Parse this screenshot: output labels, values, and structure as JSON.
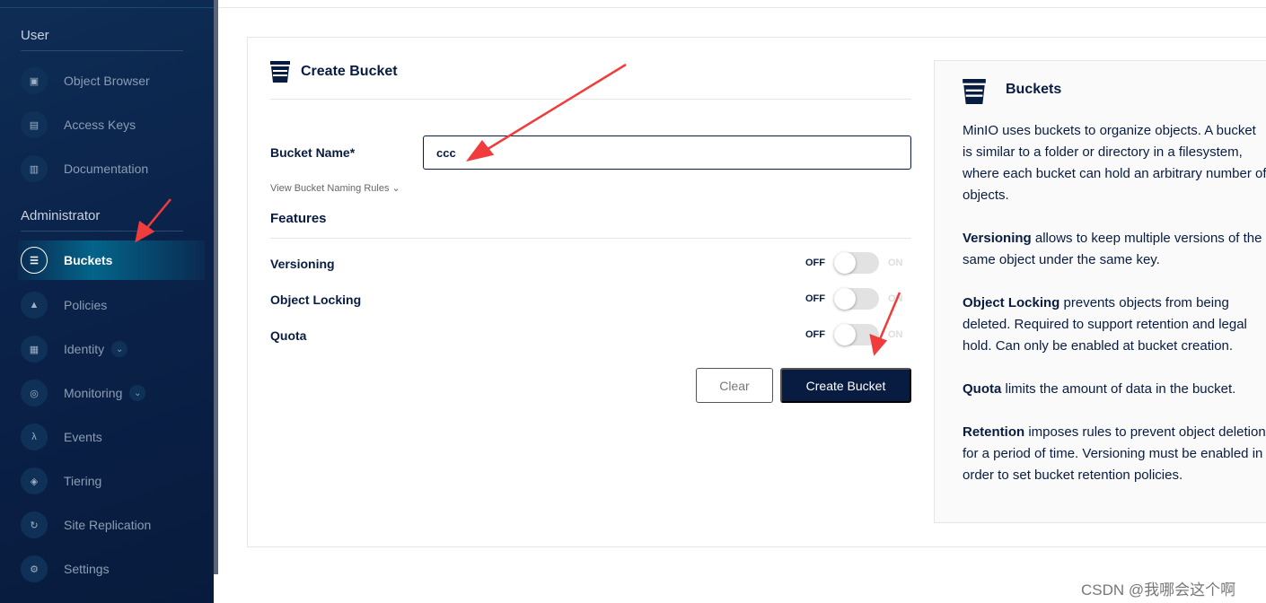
{
  "sidebar": {
    "sections": {
      "user": "User",
      "admin": "Administrator"
    },
    "items": [
      {
        "label": "Object Browser",
        "icon": "object-browser-icon",
        "glyph": "▣"
      },
      {
        "label": "Access Keys",
        "icon": "access-keys-icon",
        "glyph": "▤"
      },
      {
        "label": "Documentation",
        "icon": "documentation-icon",
        "glyph": "▥"
      },
      {
        "label": "Buckets",
        "icon": "bucket-icon",
        "glyph": "☰",
        "active": true
      },
      {
        "label": "Policies",
        "icon": "lock-icon",
        "glyph": "▲"
      },
      {
        "label": "Identity",
        "icon": "identity-icon",
        "glyph": "▦",
        "chevron": "⌄"
      },
      {
        "label": "Monitoring",
        "icon": "monitoring-icon",
        "glyph": "◎",
        "chevron": "⌄"
      },
      {
        "label": "Events",
        "icon": "lambda-icon",
        "glyph": "λ"
      },
      {
        "label": "Tiering",
        "icon": "tiering-icon",
        "glyph": "◈"
      },
      {
        "label": "Site Replication",
        "icon": "replication-icon",
        "glyph": "↻"
      },
      {
        "label": "Settings",
        "icon": "gear-icon",
        "glyph": "⚙"
      }
    ]
  },
  "form": {
    "title": "Create Bucket",
    "bucket_name_label": "Bucket Name*",
    "bucket_name_value": "ccc",
    "naming_rules": "View Bucket Naming Rules ⌄",
    "features_title": "Features",
    "features": [
      {
        "label": "Versioning",
        "off": "OFF",
        "on": "ON",
        "enabled": false
      },
      {
        "label": "Object Locking",
        "off": "OFF",
        "on": "ON",
        "enabled": false
      },
      {
        "label": "Quota",
        "off": "OFF",
        "on": "ON",
        "enabled": false
      }
    ],
    "clear_label": "Clear",
    "create_label": "Create Bucket"
  },
  "help": {
    "title": "Buckets",
    "intro": "MinIO uses buckets to organize objects. A bucket is similar to a folder or directory in a filesystem, where each bucket can hold an arbitrary number of objects.",
    "paras": [
      {
        "term": "Versioning",
        "text": " allows to keep multiple versions of the same object under the same key."
      },
      {
        "term": "Object Locking",
        "text": " prevents objects from being deleted. Required to support retention and legal hold. Can only be enabled at bucket creation."
      },
      {
        "term": "Quota",
        "text": " limits the amount of data in the bucket."
      },
      {
        "term": "Retention",
        "text": " imposes rules to prevent object deletion for a period of time. Versioning must be enabled in order to set bucket retention policies."
      }
    ]
  },
  "watermark": "CSDN @我哪会这个啊",
  "colors": {
    "sidebar": "#0a2148",
    "accent": "#081c42",
    "annotation": "#f03c3c"
  }
}
